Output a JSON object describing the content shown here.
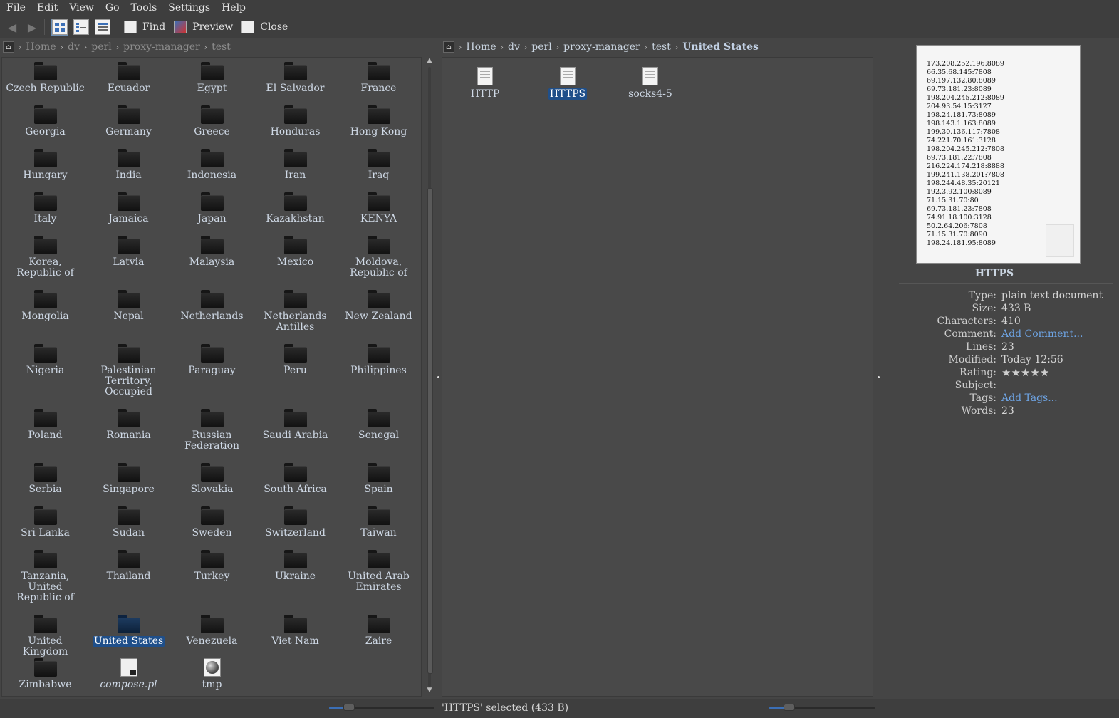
{
  "menubar": {
    "items": [
      "File",
      "Edit",
      "View",
      "Go",
      "Tools",
      "Settings",
      "Help"
    ]
  },
  "toolbar": {
    "find_label": "Find",
    "preview_label": "Preview",
    "close_label": "Close"
  },
  "left_breadcrumb": [
    "Home",
    "dv",
    "perl",
    "proxy-manager",
    "test"
  ],
  "right_breadcrumb": [
    "Home",
    "dv",
    "perl",
    "proxy-manager",
    "test",
    "United States"
  ],
  "left_items": [
    {
      "label": "Czech Republic",
      "type": "folder"
    },
    {
      "label": "Ecuador",
      "type": "folder"
    },
    {
      "label": "Egypt",
      "type": "folder"
    },
    {
      "label": "El Salvador",
      "type": "folder"
    },
    {
      "label": "France",
      "type": "folder"
    },
    {
      "label": "Georgia",
      "type": "folder"
    },
    {
      "label": "Germany",
      "type": "folder"
    },
    {
      "label": "Greece",
      "type": "folder"
    },
    {
      "label": "Honduras",
      "type": "folder"
    },
    {
      "label": "Hong Kong",
      "type": "folder"
    },
    {
      "label": "Hungary",
      "type": "folder"
    },
    {
      "label": "India",
      "type": "folder"
    },
    {
      "label": "Indonesia",
      "type": "folder"
    },
    {
      "label": "Iran",
      "type": "folder"
    },
    {
      "label": "Iraq",
      "type": "folder"
    },
    {
      "label": "Italy",
      "type": "folder"
    },
    {
      "label": "Jamaica",
      "type": "folder"
    },
    {
      "label": "Japan",
      "type": "folder"
    },
    {
      "label": "Kazakhstan",
      "type": "folder"
    },
    {
      "label": "KENYA",
      "type": "folder"
    },
    {
      "label": "Korea, Republic of",
      "type": "folder"
    },
    {
      "label": "Latvia",
      "type": "folder"
    },
    {
      "label": "Malaysia",
      "type": "folder"
    },
    {
      "label": "Mexico",
      "type": "folder"
    },
    {
      "label": "Moldova, Republic of",
      "type": "folder"
    },
    {
      "label": "Mongolia",
      "type": "folder"
    },
    {
      "label": "Nepal",
      "type": "folder"
    },
    {
      "label": "Netherlands",
      "type": "folder"
    },
    {
      "label": "Netherlands Antilles",
      "type": "folder"
    },
    {
      "label": "New Zealand",
      "type": "folder"
    },
    {
      "label": "Nigeria",
      "type": "folder"
    },
    {
      "label": "Palestinian Territory, Occupied",
      "type": "folder"
    },
    {
      "label": "Paraguay",
      "type": "folder"
    },
    {
      "label": "Peru",
      "type": "folder"
    },
    {
      "label": "Philippines",
      "type": "folder"
    },
    {
      "label": "Poland",
      "type": "folder"
    },
    {
      "label": "Romania",
      "type": "folder"
    },
    {
      "label": "Russian Federation",
      "type": "folder"
    },
    {
      "label": "Saudi Arabia",
      "type": "folder"
    },
    {
      "label": "Senegal",
      "type": "folder"
    },
    {
      "label": "Serbia",
      "type": "folder"
    },
    {
      "label": "Singapore",
      "type": "folder"
    },
    {
      "label": "Slovakia",
      "type": "folder"
    },
    {
      "label": "South Africa",
      "type": "folder"
    },
    {
      "label": "Spain",
      "type": "folder"
    },
    {
      "label": "Sri Lanka",
      "type": "folder"
    },
    {
      "label": "Sudan",
      "type": "folder"
    },
    {
      "label": "Sweden",
      "type": "folder"
    },
    {
      "label": "Switzerland",
      "type": "folder"
    },
    {
      "label": "Taiwan",
      "type": "folder"
    },
    {
      "label": "Tanzania, United Republic of",
      "type": "folder"
    },
    {
      "label": "Thailand",
      "type": "folder"
    },
    {
      "label": "Turkey",
      "type": "folder"
    },
    {
      "label": "Ukraine",
      "type": "folder"
    },
    {
      "label": "United Arab Emirates",
      "type": "folder"
    },
    {
      "label": "United Kingdom",
      "type": "folder"
    },
    {
      "label": "United States",
      "type": "folder",
      "selected": true
    },
    {
      "label": "Venezuela",
      "type": "folder"
    },
    {
      "label": "Viet Nam",
      "type": "folder"
    },
    {
      "label": "Zaire",
      "type": "folder"
    },
    {
      "label": "Zimbabwe",
      "type": "folder"
    },
    {
      "label": "compose.pl",
      "type": "script"
    },
    {
      "label": "tmp",
      "type": "globe"
    }
  ],
  "right_items": [
    {
      "label": "HTTP",
      "selected": false
    },
    {
      "label": "HTTPS",
      "selected": true
    },
    {
      "label": "socks4-5",
      "selected": false
    }
  ],
  "preview_lines": [
    "173.208.252.196:8089",
    "66.35.68.145:7808",
    "69.197.132.80:8089",
    "69.73.181.23:8089",
    "198.204.245.212:8089",
    "204.93.54.15:3127",
    "198.24.181.73:8089",
    "198.143.1.163:8089",
    "199.30.136.117:7808",
    "74.221.70.161:3128",
    "198.204.245.212:7808",
    "69.73.181.22:7808",
    "216.224.174.218:8888",
    "199.241.138.201:7808",
    "198.244.48.35:20121",
    "192.3.92.100:8089",
    "71.15.31.70:80",
    "69.73.181.23:7808",
    "74.91.18.100:3128",
    "50.2.64.206:7808",
    "71.15.31.70:8090",
    "198.24.181.95:8089"
  ],
  "info": {
    "title": "HTTPS",
    "rows": [
      {
        "k": "Type:",
        "v": "plain text document"
      },
      {
        "k": "Size:",
        "v": "433 B"
      },
      {
        "k": "Characters:",
        "v": "410"
      },
      {
        "k": "Comment:",
        "v": "Add Comment...",
        "link": true
      },
      {
        "k": "Lines:",
        "v": "23"
      },
      {
        "k": "Modified:",
        "v": "Today 12:56"
      },
      {
        "k": "Rating:",
        "v": "",
        "stars": 5
      },
      {
        "k": "Subject:",
        "v": ""
      },
      {
        "k": "Tags:",
        "v": "Add Tags...",
        "link": true
      },
      {
        "k": "Words:",
        "v": "23"
      }
    ]
  },
  "status": {
    "text": "'HTTPS' selected (433 B)"
  },
  "colors": {
    "accent": "#1f4f8a",
    "link": "#6ea4e4",
    "background": "#454545"
  }
}
